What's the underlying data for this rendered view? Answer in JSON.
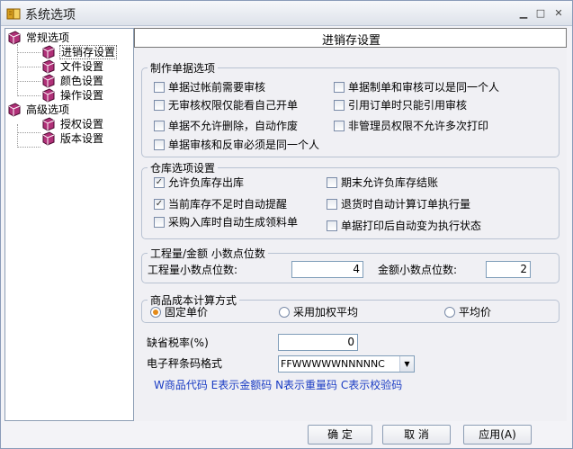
{
  "window": {
    "title": "系统选项"
  },
  "sidebar": {
    "groups": [
      {
        "label": "常规选项",
        "items": [
          "进销存设置",
          "文件设置",
          "颜色设置",
          "操作设置"
        ]
      },
      {
        "label": "高级选项",
        "items": [
          "授权设置",
          "版本设置"
        ]
      }
    ]
  },
  "content": {
    "header": "进销存设置",
    "documents": {
      "title": "制作单据选项",
      "options": [
        {
          "label": "单据过帐前需要审核",
          "checked": false
        },
        {
          "label": "单据制单和审核可以是同一个人",
          "checked": false
        },
        {
          "label": "无审核权限仅能看自己开单",
          "checked": false
        },
        {
          "label": "引用订单时只能引用审核",
          "checked": false
        },
        {
          "label": "单据不允许删除，自动作废",
          "checked": false
        },
        {
          "label": "非管理员权限不允许多次打印",
          "checked": false
        },
        {
          "label": "单据审核和反审必须是同一个人",
          "checked": false
        }
      ]
    },
    "warehouse": {
      "title": "仓库选项设置",
      "options": [
        {
          "label": "允许负库存出库",
          "checked": true
        },
        {
          "label": "期末允许负库存结账",
          "checked": false
        },
        {
          "label": "当前库存不足时自动提醒",
          "checked": true
        },
        {
          "label": "退货时自动计算订单执行量",
          "checked": false
        },
        {
          "label": "采购入库时自动生成领料单",
          "checked": false
        },
        {
          "label": "单据打印后自动变为执行状态",
          "checked": false
        }
      ]
    },
    "decimals": {
      "title": "工程量/金额  小数点位数",
      "quantity_label": "工程量小数点位数:",
      "quantity_value": "4",
      "amount_label": "金额小数点位数:",
      "amount_value": "2"
    },
    "costing": {
      "title": "商品成本计算方式",
      "options": [
        {
          "label": "固定单价",
          "selected": true
        },
        {
          "label": "采用加权平均",
          "selected": false
        },
        {
          "label": "平均价",
          "selected": false
        }
      ]
    },
    "tax": {
      "label": "缺省税率(%)",
      "value": "0"
    },
    "barcode": {
      "label": "电子秤条码格式",
      "value": "FFWWWWWNNNNNC",
      "hint": "W商品代码 E表示金额码 N表示重量码 C表示校验码"
    }
  },
  "footer": {
    "ok_label": "确  定",
    "cancel_label": "取  消",
    "apply_label": "应用(A)"
  }
}
